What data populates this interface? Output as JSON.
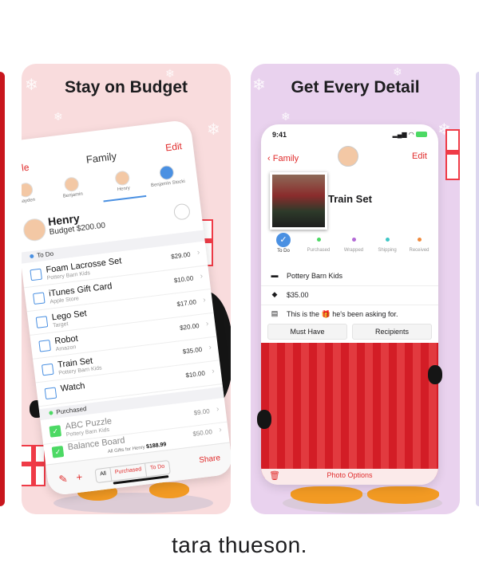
{
  "cards": [
    {
      "title": "Stay on Budget",
      "phone": {
        "nav": {
          "back_label": "ople",
          "title": "Family",
          "edit_label": "Edit"
        },
        "people": [
          "Hayden",
          "Benjamin",
          "Henry",
          "Benjamin Stocki"
        ],
        "recipient": {
          "name": "Henry",
          "budget": "Budget $200.00"
        },
        "todo_header": "To Do",
        "todo_items": [
          {
            "name": "Foam Lacrosse Set",
            "store": "Pottery Barn Kids",
            "price": "$29.00"
          },
          {
            "name": "iTunes Gift Card",
            "store": "Apple Store",
            "price": "$10.00"
          },
          {
            "name": "Lego Set",
            "store": "Target",
            "price": "$17.00"
          },
          {
            "name": "Robot",
            "store": "Amazon",
            "price": "$20.00"
          },
          {
            "name": "Train Set",
            "store": "Pottery Barn Kids",
            "price": "$35.00"
          },
          {
            "name": "Watch",
            "store": "",
            "price": "$10.00"
          }
        ],
        "purchased_header": "Purchased",
        "purchased_items": [
          {
            "name": "ABC Puzzle",
            "store": "Pottery Barn Kids",
            "price": "$9.00"
          },
          {
            "name": "Balance Board",
            "store": "",
            "price": "$50.00"
          }
        ],
        "total_label": "All Gifts for Henry",
        "total_value": "$188.99",
        "toolbar": {
          "segments": [
            "All",
            "Purchased",
            "To Do"
          ],
          "share_label": "Share"
        }
      }
    },
    {
      "title": "Get Every Detail",
      "phone": {
        "status_time": "9:41",
        "back_label": "Family",
        "edit_label": "Edit",
        "item_name": "Train Set",
        "statuses": [
          "To Do",
          "Purchased",
          "Wrapped",
          "Shipping",
          "Received"
        ],
        "status_colors": [
          "#4a90e2",
          "#4cd964",
          "#b36ad6",
          "#3fc7c7",
          "#f08a3c"
        ],
        "store": "Pottery Barn Kids",
        "price": "$35.00",
        "note": "This is the 🎁 he's been asking for.",
        "buttons": [
          "Must Have",
          "Recipients"
        ],
        "bottom_label": "Photo Options"
      }
    }
  ],
  "credit": "tara thueson.",
  "colors": {
    "accent": "#e02b2b",
    "card1_bg": "#f9dcdd",
    "card2_bg": "#e9d2ee",
    "curtain": "#d31d26"
  }
}
